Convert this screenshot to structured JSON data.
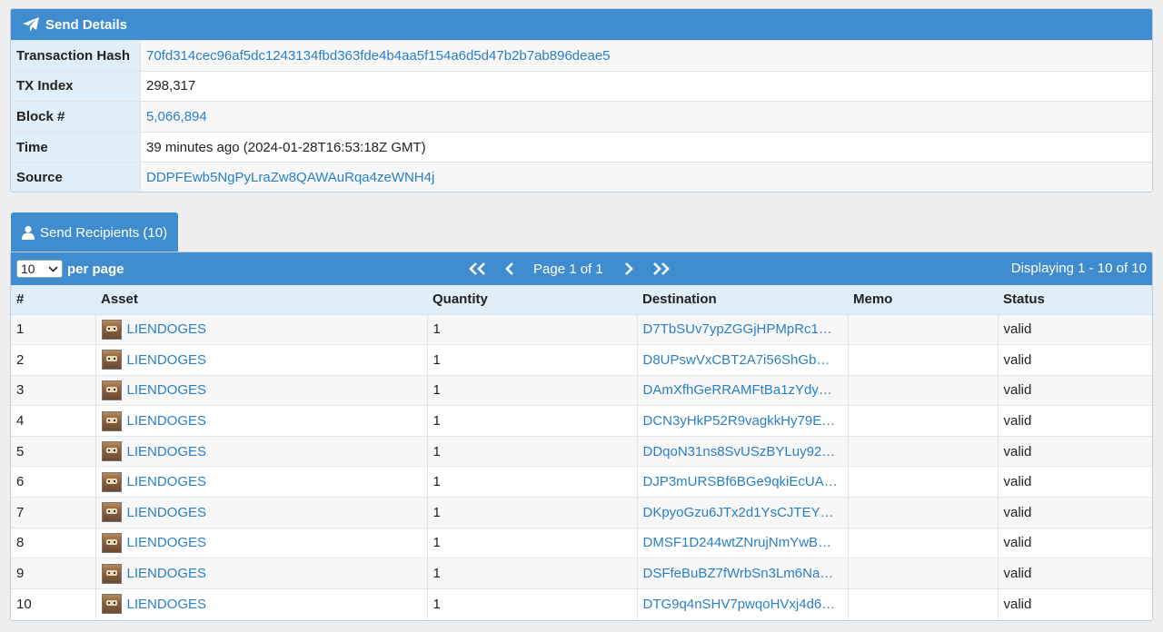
{
  "details": {
    "title": "Send Details",
    "rows": [
      {
        "label": "Transaction Hash",
        "value": "70fd314cec96af5dc1243134fbd363fde4b4aa5f154a6d5d47b2b7ab896deae5"
      },
      {
        "label": "TX Index",
        "value": "298,317"
      },
      {
        "label": "Block #",
        "value": "5,066,894"
      },
      {
        "label": "Time",
        "value": "39 minutes ago (2024-01-28T16:53:18Z GMT)"
      },
      {
        "label": "Source",
        "value": "DDPFEwb5NgPyLraZw8QAWAuRqa4zeWNH4j"
      }
    ]
  },
  "recipients": {
    "tab_label": "Send Recipients (10)",
    "per_page_value": "10",
    "per_page_label": "per page",
    "page_text": "Page 1 of 1",
    "displaying": "Displaying 1 - 10 of 10",
    "columns": [
      "#",
      "Asset",
      "Quantity",
      "Destination",
      "Memo",
      "Status"
    ],
    "rows": [
      {
        "n": "1",
        "asset": "LIENDOGES",
        "qty": "1",
        "dest": "D7TbSUv7ypZGGjHPMpRc1…",
        "memo": "",
        "status": "valid"
      },
      {
        "n": "2",
        "asset": "LIENDOGES",
        "qty": "1",
        "dest": "D8UPswVxCBT2A7i56ShGb…",
        "memo": "",
        "status": "valid"
      },
      {
        "n": "3",
        "asset": "LIENDOGES",
        "qty": "1",
        "dest": "DAmXfhGeRRAMFtBa1zYdy…",
        "memo": "",
        "status": "valid"
      },
      {
        "n": "4",
        "asset": "LIENDOGES",
        "qty": "1",
        "dest": "DCN3yHkP52R9vagkkHy79E…",
        "memo": "",
        "status": "valid"
      },
      {
        "n": "5",
        "asset": "LIENDOGES",
        "qty": "1",
        "dest": "DDqoN31ns8SvUSzBYLuy92…",
        "memo": "",
        "status": "valid"
      },
      {
        "n": "6",
        "asset": "LIENDOGES",
        "qty": "1",
        "dest": "DJP3mURSBf6BGe9qkiEcUA…",
        "memo": "",
        "status": "valid"
      },
      {
        "n": "7",
        "asset": "LIENDOGES",
        "qty": "1",
        "dest": "DKpyoGzu6JTx2d1YsCJTEY…",
        "memo": "",
        "status": "valid"
      },
      {
        "n": "8",
        "asset": "LIENDOGES",
        "qty": "1",
        "dest": "DMSF1D244wtZNrujNmYwB…",
        "memo": "",
        "status": "valid"
      },
      {
        "n": "9",
        "asset": "LIENDOGES",
        "qty": "1",
        "dest": "DSFfeBuBZ7fWrbSn3Lm6Na…",
        "memo": "",
        "status": "valid"
      },
      {
        "n": "10",
        "asset": "LIENDOGES",
        "qty": "1",
        "dest": "DTG9q4nSHV7pwqoHVxj4d6…",
        "memo": "",
        "status": "valid"
      }
    ]
  },
  "colors": {
    "accent": "#3f8ccf",
    "link": "#2a7fc4",
    "label_bg": "#dfeef9"
  }
}
